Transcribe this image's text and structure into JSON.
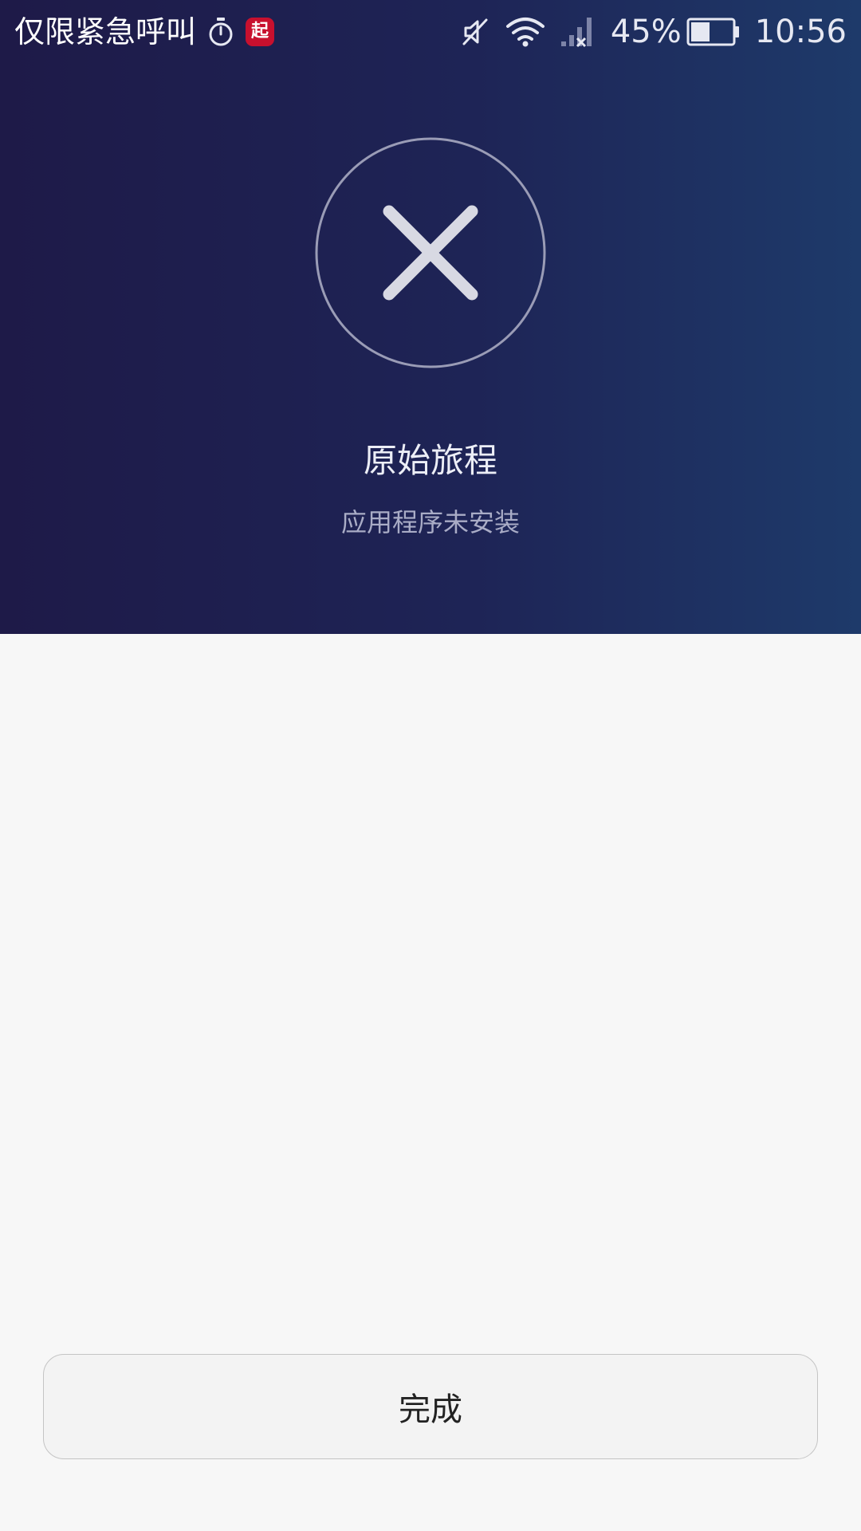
{
  "status_bar": {
    "carrier_text": "仅限紧急呼叫",
    "app_badge_text": "起",
    "battery_percent": "45%",
    "battery_level": 0.45,
    "time": "10:56",
    "icons": [
      "timer-icon",
      "app-notification-icon",
      "muted-icon",
      "wifi-icon",
      "no-signal-icon",
      "battery-icon"
    ]
  },
  "result": {
    "icon": "close-icon",
    "app_name": "原始旅程",
    "message": "应用程序未安装"
  },
  "actions": {
    "done_label": "完成"
  },
  "colors": {
    "header_gradient_start": "#1e1a48",
    "header_gradient_end": "#1e3a6a",
    "page_background": "#f7f7f7",
    "badge_red": "#c8102e"
  }
}
